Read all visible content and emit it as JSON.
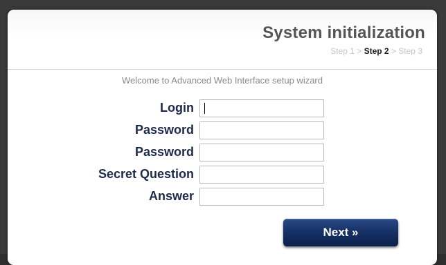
{
  "header": {
    "title": "System initialization",
    "steps": {
      "step1": "Step 1",
      "sep1": " > ",
      "step2": "Step 2",
      "sep2": " > ",
      "step3": "Step 3",
      "active": "Step 2"
    }
  },
  "welcome_text": "Welcome to Advanced Web Interface setup wizard",
  "form": {
    "fields": [
      {
        "label": "Login",
        "value": ""
      },
      {
        "label": "Password",
        "value": ""
      },
      {
        "label": "Password",
        "value": ""
      },
      {
        "label": "Secret Question",
        "value": ""
      },
      {
        "label": "Answer",
        "value": ""
      }
    ]
  },
  "next_button": {
    "label": "Next »"
  },
  "colors": {
    "button": "#183268",
    "label": "#1d2a4a",
    "title": "#555555",
    "welcome": "#8a8a8a",
    "steps_inactive": "#c4c4c4"
  }
}
